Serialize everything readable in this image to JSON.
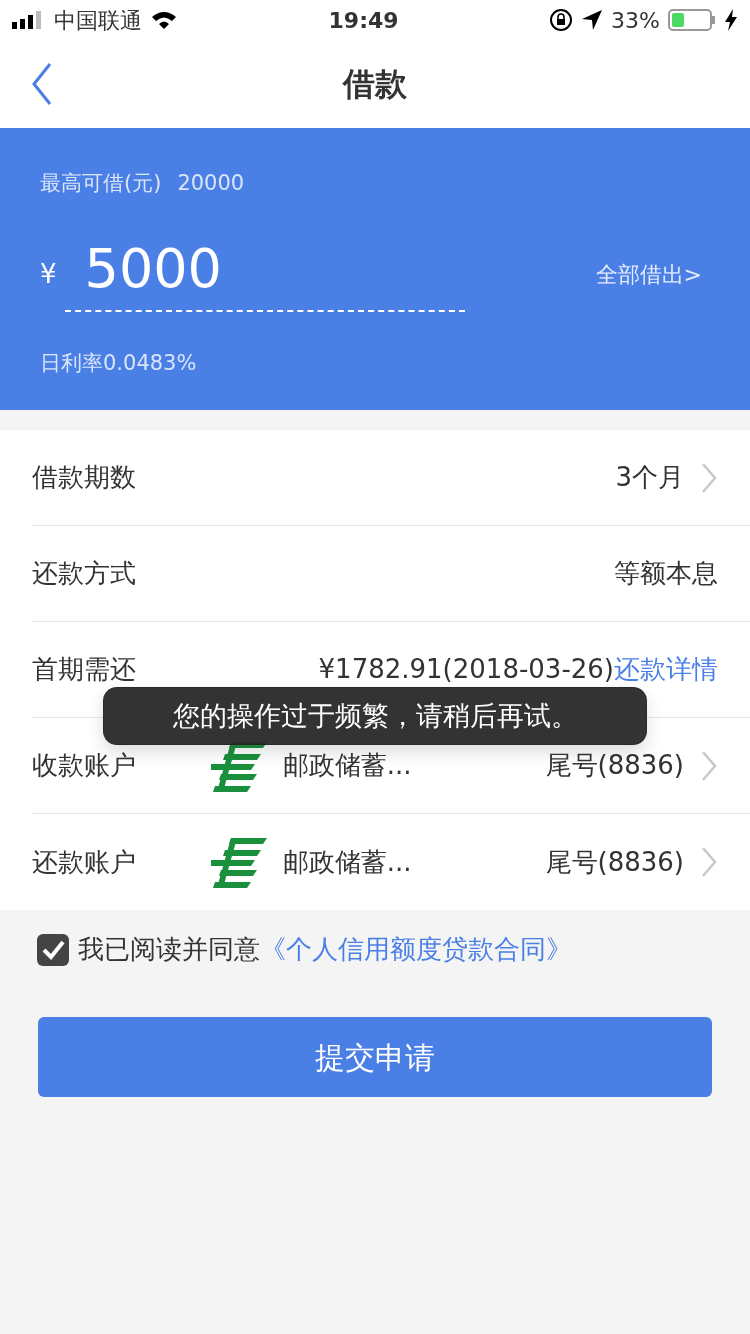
{
  "status_bar": {
    "carrier": "中国联通",
    "time": "19:49",
    "battery": "33%"
  },
  "nav": {
    "title": "借款"
  },
  "loan": {
    "limit_label": "最高可借(元)",
    "limit": "20000",
    "currency": "¥",
    "amount": "5000",
    "borrow_all": "全部借出>",
    "rate": "日利率0.0483%"
  },
  "rows": [
    {
      "kind": "select",
      "label": "借款期数",
      "value": "3个月"
    },
    {
      "kind": "text",
      "label": "还款方式",
      "value": "等额本息"
    },
    {
      "kind": "detail",
      "label": "首期需还",
      "value": "¥1782.91(2018-03-26)",
      "link": "还款详情"
    },
    {
      "kind": "account",
      "label": "收款账户",
      "bank": "邮政储蓄...",
      "tail": "尾号(8836)"
    },
    {
      "kind": "account",
      "label": "还款账户",
      "bank": "邮政储蓄...",
      "tail": "尾号(8836)"
    }
  ],
  "agreement": {
    "checked": true,
    "text": "我已阅读并同意",
    "link": "《个人信用额度贷款合同》"
  },
  "submit": "提交申请",
  "toast": "您的操作过于频繁，请稍后再试。"
}
